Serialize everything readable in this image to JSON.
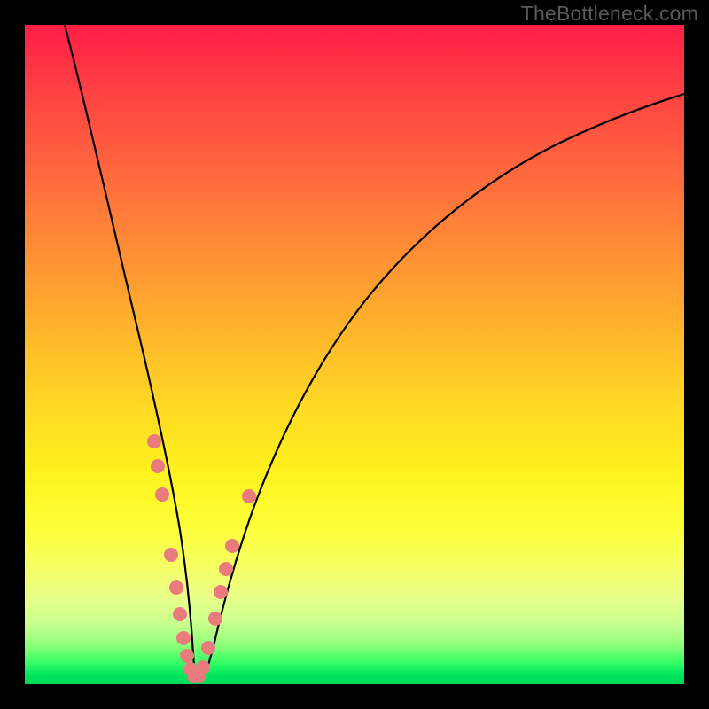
{
  "watermark": "TheBottleneck.com",
  "chart_data": {
    "type": "line",
    "title": "",
    "xlabel": "",
    "ylabel": "",
    "xlim": [
      0,
      100
    ],
    "ylim": [
      0,
      100
    ],
    "grid": false,
    "legend": false,
    "description": "Bottleneck percentage curve dipping to near zero around x≈25 then rising asymptotically; no axis tick labels shown",
    "gradient_stops": [
      {
        "pos": 0,
        "color": "#ff1e46"
      },
      {
        "pos": 0.48,
        "color": "#ffd924"
      },
      {
        "pos": 0.76,
        "color": "#fcff38"
      },
      {
        "pos": 0.97,
        "color": "#3dff66"
      },
      {
        "pos": 1.0,
        "color": "#00d858"
      }
    ],
    "series": [
      {
        "name": "bottleneck-curve",
        "x": [
          6,
          10,
          14,
          18,
          21,
          23,
          24,
          25,
          26,
          28,
          30,
          33,
          38,
          44,
          52,
          62,
          74,
          88,
          100
        ],
        "y": [
          100,
          82,
          62,
          42,
          24,
          11,
          4,
          1,
          3,
          9,
          18,
          28,
          40,
          50,
          58,
          65,
          71,
          76,
          79
        ]
      }
    ],
    "data_markers": {
      "name": "highlighted-points",
      "points": [
        {
          "x": 19.0,
          "y": 37
        },
        {
          "x": 19.6,
          "y": 33
        },
        {
          "x": 20.4,
          "y": 28
        },
        {
          "x": 21.8,
          "y": 19
        },
        {
          "x": 22.6,
          "y": 14
        },
        {
          "x": 23.2,
          "y": 10
        },
        {
          "x": 23.8,
          "y": 6.5
        },
        {
          "x": 24.3,
          "y": 4
        },
        {
          "x": 24.8,
          "y": 2
        },
        {
          "x": 25.3,
          "y": 1.2
        },
        {
          "x": 25.9,
          "y": 1.5
        },
        {
          "x": 26.6,
          "y": 3
        },
        {
          "x": 27.4,
          "y": 6
        },
        {
          "x": 28.4,
          "y": 10.5
        },
        {
          "x": 29.2,
          "y": 14.5
        },
        {
          "x": 30.0,
          "y": 18
        },
        {
          "x": 30.9,
          "y": 21.5
        },
        {
          "x": 33.4,
          "y": 29
        }
      ]
    }
  }
}
